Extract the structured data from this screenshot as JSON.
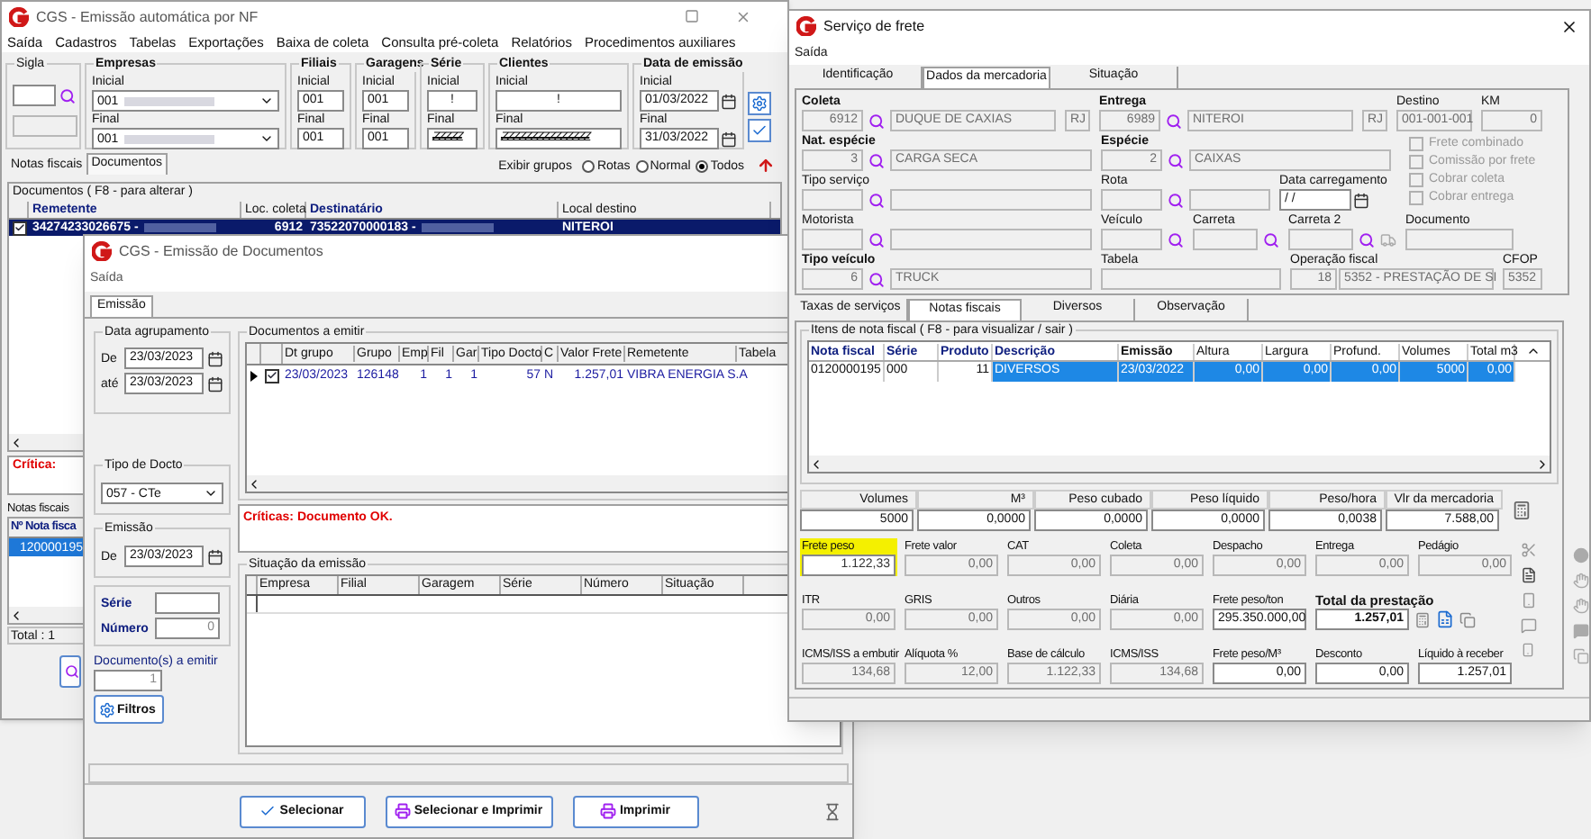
{
  "win1": {
    "title": "CGS - Emissão automática por NF",
    "menu": [
      "Saída",
      "Cadastros",
      "Tabelas",
      "Exportações",
      "Baixa de coleta",
      "Consulta pré-coleta",
      "Relatórios",
      "Procedimentos auxiliares"
    ],
    "filter_groups": [
      {
        "kind": "sigla",
        "label": "Sigla"
      },
      {
        "kind": "range",
        "label": "Empresas",
        "rows": [
          {
            "label": "Inicial",
            "value": "001",
            "kind": "select"
          },
          {
            "label": "Final",
            "value": "001",
            "kind": "select"
          }
        ]
      },
      {
        "kind": "range",
        "label": "Filiais",
        "rows": [
          {
            "label": "Inicial",
            "value": "001",
            "kind": "text"
          },
          {
            "label": "Final",
            "value": "001",
            "kind": "text"
          }
        ]
      },
      {
        "kind": "range",
        "label": "Garagens",
        "rows": [
          {
            "label": "Inicial",
            "value": "001",
            "kind": "text"
          },
          {
            "label": "Final",
            "value": "001",
            "kind": "text"
          }
        ]
      },
      {
        "kind": "range",
        "label": "Série",
        "rows": [
          {
            "label": "Inicial",
            "value": "!",
            "kind": "center"
          },
          {
            "label": "Final",
            "value": "ZZZZZ",
            "kind": "hatched"
          }
        ]
      },
      {
        "kind": "range",
        "label": "Clientes",
        "rows": [
          {
            "label": "Inicial",
            "value": "!",
            "kind": "center"
          },
          {
            "label": "Final",
            "value": "ZZZZZZZZZZZZZZZ",
            "kind": "hatched"
          }
        ]
      },
      {
        "kind": "range",
        "label": "Data de emissão",
        "rows": [
          {
            "label": "Inicial",
            "value": "01/03/2022",
            "kind": "date"
          },
          {
            "label": "Final",
            "value": "31/03/2022",
            "kind": "date"
          }
        ]
      }
    ],
    "tabs": [
      {
        "label": "Notas fiscais",
        "selected": false
      },
      {
        "label": "Documentos",
        "selected": true
      }
    ],
    "groups": {
      "label": "Exibir grupos",
      "options": [
        {
          "label": "Rotas",
          "selected": false
        },
        {
          "label": "Normal",
          "selected": false
        },
        {
          "label": "Todos",
          "selected": true
        }
      ]
    },
    "grid": {
      "caption": "Documentos ( F8 - para alterar )",
      "columns": [
        {
          "label": "Remetente",
          "bold": true
        },
        {
          "label": "Loc. coleta",
          "bold": false
        },
        {
          "label": "Destinatário",
          "bold": true
        },
        {
          "label": "Local destino",
          "bold": false
        }
      ],
      "rows": [
        {
          "checked": true,
          "selected": true,
          "cells": [
            "34274233026675 -",
            "6912",
            "73522070000183 -",
            "NITEROI"
          ]
        }
      ]
    },
    "critica": "Crítica:",
    "notas_label": "Notas fiscais",
    "notas_grid": {
      "columns": [
        "Nº Nota fisca"
      ],
      "rows": [
        {
          "selected": true,
          "cells": [
            "120000195"
          ]
        }
      ]
    },
    "total": "Total : 1"
  },
  "win2": {
    "title": "CGS - Emissão de Documentos",
    "menu": [
      "Saída"
    ],
    "tabs": [
      {
        "label": "Emissão",
        "selected": true
      }
    ],
    "agrupamento": {
      "label": "Data agrupamento",
      "rows": [
        {
          "label": "De",
          "value": "23/03/2023"
        },
        {
          "label": "até",
          "value": "23/03/2023"
        }
      ]
    },
    "tipo_docto": {
      "label": "Tipo de Docto",
      "value": "057 - CTe"
    },
    "emissao": {
      "label": "Emissão",
      "rows": [
        {
          "label": "De",
          "value": "23/03/2023"
        }
      ]
    },
    "serie_label": "Série",
    "numero_label": "Número",
    "numero": "0",
    "a_emitir": {
      "label": "Documento(s) a emitir",
      "value": "1"
    },
    "filtros": "Filtros",
    "documentos": {
      "title": "Documentos a emitir",
      "columns": [
        "Dt grupo",
        "Grupo",
        "Emp",
        "Fil",
        "Gar",
        "Tipo Docto",
        "C",
        "Valor Frete",
        "Remetente",
        "Tabela"
      ],
      "rows": [
        {
          "current": true,
          "checked": true,
          "cells": [
            "23/03/2023",
            "126148",
            "1",
            "1",
            "1",
            "57",
            "N",
            "1.257,01",
            "VIBRA ENERGIA S.A"
          ]
        }
      ]
    },
    "criticas": "Críticas: Documento OK.",
    "situacao": {
      "title": "Situação da emissão",
      "columns": [
        "Empresa",
        "Filial",
        "Garagem",
        "Série",
        "Número",
        "Situação"
      ]
    },
    "buttons": [
      {
        "label": "Selecionar",
        "kind": "check"
      },
      {
        "label": "Selecionar e Imprimir",
        "kind": "print"
      },
      {
        "label": "Imprimir",
        "kind": "print"
      }
    ]
  },
  "win3": {
    "title": "Serviço de frete",
    "menu": [
      "Saída"
    ],
    "tabs": [
      {
        "label": "Identificação",
        "selected": false
      },
      {
        "label": "Dados da mercadoria",
        "selected": true
      },
      {
        "label": "Situação",
        "selected": false
      }
    ],
    "coleta": {
      "label": "Coleta",
      "code": "6912",
      "name": "DUQUE DE CAXIAS",
      "uf": "RJ"
    },
    "entrega": {
      "label": "Entrega",
      "code": "6989",
      "name": "NITEROI",
      "uf": "RJ"
    },
    "destino": {
      "label": "Destino",
      "value": "001-001-001"
    },
    "km": {
      "label": "KM",
      "value": "0"
    },
    "nat_especie": {
      "label": "Nat. espécie",
      "code": "3",
      "name": "CARGA SECA"
    },
    "especie": {
      "label": "Espécie",
      "code": "2",
      "name": "CAIXAS"
    },
    "options": [
      {
        "label": "Frete combinado",
        "checked": false
      },
      {
        "label": "Comissão por frete",
        "checked": false
      },
      {
        "label": "Cobrar coleta",
        "checked": false
      },
      {
        "label": "Cobrar entrega",
        "checked": false
      }
    ],
    "tipo_servico": {
      "label": "Tipo serviço"
    },
    "rota": {
      "label": "Rota"
    },
    "data_carregamento": {
      "label": "Data carregamento",
      "value": "/ /"
    },
    "motorista": {
      "label": "Motorista"
    },
    "veiculo": {
      "label": "Veículo"
    },
    "carreta": {
      "label": "Carreta"
    },
    "carreta2": {
      "label": "Carreta 2"
    },
    "documento": {
      "label": "Documento"
    },
    "tipo_veiculo": {
      "label": "Tipo veículo",
      "code": "6",
      "name": "TRUCK"
    },
    "tabela": {
      "label": "Tabela"
    },
    "operacao": {
      "label": "Operação fiscal",
      "code": "18",
      "name": "5352 - PRESTAÇÃO DE SI"
    },
    "cfop": {
      "label": "CFOP",
      "value": "5352"
    },
    "subtabs": [
      {
        "label": "Taxas de serviços",
        "selected": false
      },
      {
        "label": "Notas fiscais",
        "selected": true
      },
      {
        "label": "Diversos",
        "selected": false
      },
      {
        "label": "Observação",
        "selected": false
      }
    ],
    "itens": {
      "caption": "Itens de nota fiscal ( F8 - para visualizar / sair )",
      "columns": [
        {
          "label": "Nota fiscal",
          "bold": true
        },
        {
          "label": "Série",
          "bold": true
        },
        {
          "label": "Produto",
          "bold": true
        },
        {
          "label": "Descrição",
          "bold": true
        },
        {
          "label": "Emissão",
          "bold": true
        },
        {
          "label": "Altura",
          "bold": false
        },
        {
          "label": "Largura",
          "bold": false
        },
        {
          "label": "Profund.",
          "bold": false
        },
        {
          "label": "Volumes",
          "bold": false
        },
        {
          "label": "Total m3",
          "bold": false
        }
      ],
      "rows": [
        {
          "selected": true,
          "cells": [
            "0120000195",
            "000",
            "11",
            "DIVERSOS",
            "23/03/2022",
            "0,00",
            "0,00",
            "0,00",
            "5000",
            "0,00"
          ]
        }
      ]
    },
    "summary": [
      {
        "label": "Volumes",
        "value": "5000"
      },
      {
        "label": "M³",
        "value": "0,0000"
      },
      {
        "label": "Peso cubado",
        "value": "0,0000"
      },
      {
        "label": "Peso líquido",
        "value": "0,0000"
      },
      {
        "label": "Peso/hora",
        "value": "0,0038"
      },
      {
        "label": "Vlr da mercadoria",
        "value": "7.588,00"
      }
    ],
    "values": [
      {
        "label": "Frete peso",
        "value": "1.122,33",
        "highlighted": true,
        "kind": "normal"
      },
      {
        "label": "Frete valor",
        "value": "0,00",
        "highlighted": false,
        "kind": "normal"
      },
      {
        "label": "CAT",
        "value": "0,00",
        "highlighted": false,
        "kind": "normal"
      },
      {
        "label": "Coleta",
        "value": "0,00",
        "highlighted": false,
        "kind": "normal"
      },
      {
        "label": "Despacho",
        "value": "0,00",
        "highlighted": false,
        "kind": "normal"
      },
      {
        "label": "Entrega",
        "value": "0,00",
        "highlighted": false,
        "kind": "normal"
      },
      {
        "label": "Pedágio",
        "value": "0,00",
        "highlighted": false,
        "kind": "normal"
      },
      {
        "label": "ITR",
        "value": "0,00",
        "highlighted": false,
        "kind": "normal"
      },
      {
        "label": "GRIS",
        "value": "0,00",
        "highlighted": false,
        "kind": "normal"
      },
      {
        "label": "Outros",
        "value": "0,00",
        "highlighted": false,
        "kind": "normal"
      },
      {
        "label": "Diária",
        "value": "0,00",
        "highlighted": false,
        "kind": "normal"
      },
      {
        "label": "Frete peso/ton",
        "value": "295.350.000,00",
        "highlighted": false,
        "kind": "active"
      },
      {
        "label": "Total da prestação",
        "value": "1.257,01",
        "highlighted": false,
        "kind": "total"
      },
      {
        "label": "ICMS/ISS a embutir",
        "value": "134,68",
        "highlighted": false,
        "kind": "normal"
      },
      {
        "label": "Alíquota %",
        "value": "12,00",
        "highlighted": false,
        "kind": "normal"
      },
      {
        "label": "Base de cálculo",
        "value": "1.122,33",
        "highlighted": false,
        "kind": "normal"
      },
      {
        "label": "ICMS/ISS",
        "value": "134,68",
        "highlighted": false,
        "kind": "normal"
      },
      {
        "label": "Frete peso/M³",
        "value": "0,00",
        "highlighted": false,
        "kind": "active"
      },
      {
        "label": "Desconto",
        "value": "0,00",
        "highlighted": false,
        "kind": "active"
      },
      {
        "label": "Líquido à receber",
        "value": "1.257,01",
        "highlighted": false,
        "kind": "active"
      }
    ]
  }
}
